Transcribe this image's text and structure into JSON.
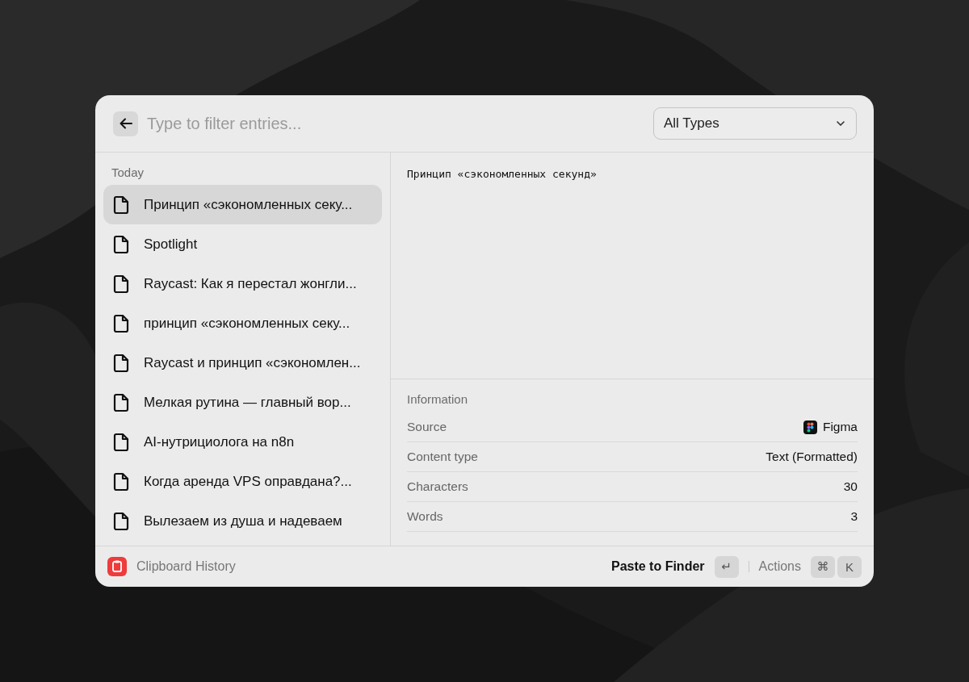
{
  "search": {
    "placeholder": "Type to filter entries..."
  },
  "type_filter": {
    "value": "All Types"
  },
  "section": "Today",
  "entries": [
    {
      "label": "Принцип «сэкономленных секу...",
      "selected": true
    },
    {
      "label": "Spotlight",
      "selected": false
    },
    {
      "label": "Raycast: Как я перестал жонгли...",
      "selected": false
    },
    {
      "label": "принцип «сэкономленных секу...",
      "selected": false
    },
    {
      "label": "Raycast и принцип «сэкономлен...",
      "selected": false
    },
    {
      "label": "Мелкая рутина — главный вор...",
      "selected": false
    },
    {
      "label": "AI-нутрициолога на n8n",
      "selected": false
    },
    {
      "label": "Когда аренда VPS оправдана?...",
      "selected": false
    },
    {
      "label": "Вылезаем из душа и надеваем",
      "selected": false
    }
  ],
  "preview": "Принцип «сэкономленных секунд»",
  "information": {
    "title": "Information",
    "rows": [
      {
        "label": "Source",
        "value": "Figma",
        "kind": "app"
      },
      {
        "label": "Content type",
        "value": "Text (Formatted)",
        "kind": "text"
      },
      {
        "label": "Characters",
        "value": "30",
        "kind": "text"
      },
      {
        "label": "Words",
        "value": "3",
        "kind": "text"
      }
    ]
  },
  "footer": {
    "title": "Clipboard History",
    "primary_action": "Paste to Finder",
    "primary_key": "↵",
    "actions_label": "Actions",
    "action_keys": [
      "⌘",
      "K"
    ]
  }
}
